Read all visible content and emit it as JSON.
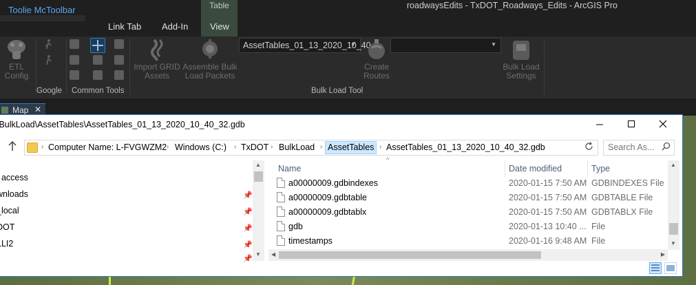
{
  "app": {
    "title": "roadwaysEdits - TxDOT_Roadways_Edits - ArcGIS Pro",
    "context_tab_group": "Table"
  },
  "ribbon_tabs": [
    "Toolie McToolbar",
    "Link Tab",
    "Add-In",
    "View"
  ],
  "ribbon": {
    "etl_config": "ETL Config",
    "import_grid": "Import GRID Assets",
    "assemble_bulk": "Assemble Bulk Load Packets",
    "asset_tables_select": "AssetTables_01_13_2020_10_40",
    "second_select": "",
    "create_routes": "Create Routes",
    "bulk_load_settings": "Bulk Load Settings",
    "groups": {
      "google": "Google",
      "common_tools": "Common Tools",
      "bulk_load_tool": "Bulk Load Tool"
    }
  },
  "map_tab": {
    "label": "Map",
    "close": "✕"
  },
  "explorer": {
    "title": "\\BulkLoad\\AssetTables\\AssetTables_01_13_2020_10_40_32.gdb",
    "breadcrumbs": [
      "Computer Name: L-FVGWZM2",
      "Windows (C:)",
      "TxDOT",
      "BulkLoad",
      "AssetTables",
      "AssetTables_01_13_2020_10_40_32.gdb"
    ],
    "search_placeholder": "Search As...",
    "nav_items": [
      {
        "label": "t access",
        "pinned": false
      },
      {
        "label": "wnloads",
        "pinned": true
      },
      {
        "label": "_local",
        "pinned": true
      },
      {
        "label": "DOT",
        "pinned": true
      },
      {
        "label": "LLI2",
        "pinned": true
      },
      {
        "label": "",
        "pinned": true
      }
    ],
    "columns": {
      "name": "Name",
      "date": "Date modified",
      "type": "Type"
    },
    "files": [
      {
        "name": "a00000009.gdbindexes",
        "date": "2020-01-15 7:50 AM",
        "type": "GDBINDEXES File"
      },
      {
        "name": "a00000009.gdbtable",
        "date": "2020-01-15 7:50 AM",
        "type": "GDBTABLE File"
      },
      {
        "name": "a00000009.gdbtablx",
        "date": "2020-01-15 7:50 AM",
        "type": "GDBTABLX File"
      },
      {
        "name": "gdb",
        "date": "2020-01-13 10:40 ...",
        "type": "File"
      },
      {
        "name": "timestamps",
        "date": "2020-01-16 9:48 AM",
        "type": "File"
      }
    ]
  }
}
